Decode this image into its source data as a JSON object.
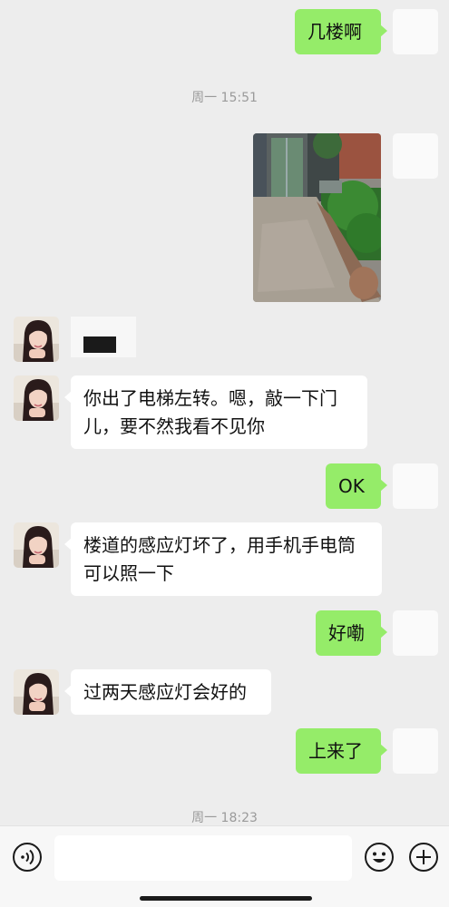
{
  "messages": {
    "m1": "几楼啊",
    "m2": "你出了电梯左转。嗯，敲一下门",
    "m2b": "儿，要不然我看不见你",
    "m3": "OK",
    "m4": "楼道的感应灯坏了，用手机手电筒",
    "m4b": "可以照一下",
    "m5": "好嘞",
    "m6": "过两天感应灯会好的",
    "m7": "上来了"
  },
  "timestamps": {
    "t1": "周一 15:51",
    "t2": "周一 18:23"
  },
  "icons": {
    "voice": "voice-input-icon",
    "emoji": "emoji-icon",
    "add": "add-icon"
  },
  "colors": {
    "outgoing_bubble": "#95ec69",
    "incoming_bubble": "#ffffff",
    "background": "#ededed"
  }
}
